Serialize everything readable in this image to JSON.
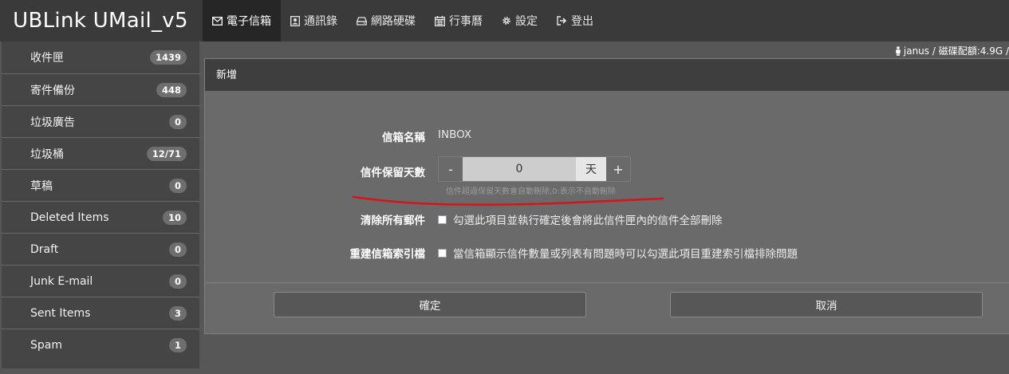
{
  "brand": {
    "title": "UBLink UMail_v5"
  },
  "nav": {
    "items": [
      {
        "label": "電子信箱",
        "icon": "envelope-icon",
        "active": true
      },
      {
        "label": "通訊錄",
        "icon": "address-book-icon",
        "active": false
      },
      {
        "label": "網路硬碟",
        "icon": "hard-drive-icon",
        "active": false
      },
      {
        "label": "行事曆",
        "icon": "calendar-icon",
        "active": false
      },
      {
        "label": "設定",
        "icon": "gear-icon",
        "active": false
      },
      {
        "label": "登出",
        "icon": "sign-out-icon",
        "active": false
      }
    ]
  },
  "sidebar": {
    "items": [
      {
        "label": "收件匣",
        "count": "1439"
      },
      {
        "label": "寄件備份",
        "count": "448"
      },
      {
        "label": "垃圾廣告",
        "count": "0"
      },
      {
        "label": "垃圾桶",
        "count": "12/71"
      },
      {
        "label": "草稿",
        "count": "0"
      },
      {
        "label": "Deleted Items",
        "count": "10"
      },
      {
        "label": "Draft",
        "count": "0"
      },
      {
        "label": "Junk E-mail",
        "count": "0"
      },
      {
        "label": "Sent Items",
        "count": "3"
      },
      {
        "label": "Spam",
        "count": "1"
      }
    ]
  },
  "userinfo": {
    "text": "janus / 磁碟配額:4.9G /",
    "icon": "user-icon"
  },
  "panel": {
    "title": "新增",
    "mailbox_name_label": "信箱名稱",
    "mailbox_name_value": "INBOX",
    "retention_label": "信件保留天數",
    "retention_minus": "-",
    "retention_value": "0",
    "retention_unit": "天",
    "retention_plus": "+",
    "retention_hint": "信件超過保留天數會自動刪除,0:表示不自動刪除",
    "clear_label": "清除所有郵件",
    "clear_text": "勾選此項目並執行確定後會將此信件匣內的信件全部刪除",
    "rebuild_label": "重建信箱索引檔",
    "rebuild_text": "當信箱顯示信件數量或列表有問題時可以勾選此項目重建索引檔排除問題",
    "confirm_label": "確定",
    "cancel_label": "取消"
  },
  "colors": {
    "annotation": "#d4151b",
    "topbar": "#3a3a3a",
    "active_tab": "#262626"
  }
}
